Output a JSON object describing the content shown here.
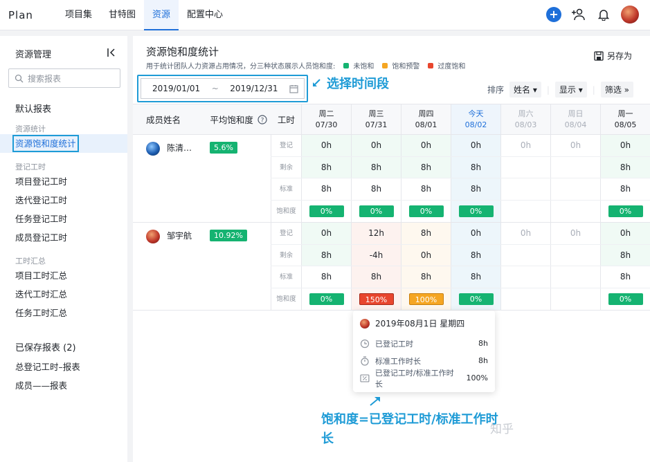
{
  "app": {
    "logo": "Plan"
  },
  "nav": {
    "items": [
      {
        "label": "项目集"
      },
      {
        "label": "甘特图"
      },
      {
        "label": "资源",
        "active": true
      },
      {
        "label": "配置中心"
      }
    ]
  },
  "topbar": {
    "add_icon": "plus-icon",
    "invite_icon": "add-user-icon",
    "bell_icon": "bell-icon"
  },
  "sidebar": {
    "title": "资源管理",
    "search_placeholder": "搜索报表",
    "default_section": "默认报表",
    "groups": [
      {
        "label": "资源统计",
        "items": [
          "资源饱和度统计"
        ]
      },
      {
        "label": "登记工时",
        "items": [
          "项目登记工时",
          "迭代登记工时",
          "任务登记工时",
          "成员登记工时"
        ]
      },
      {
        "label": "工时汇总",
        "items": [
          "项目工时汇总",
          "迭代工时汇总",
          "任务工时汇总"
        ]
      }
    ],
    "saved_title": "已保存报表 (2)",
    "saved_items": [
      "总登记工时–报表",
      "成员——报表"
    ]
  },
  "main": {
    "title": "资源饱和度统计",
    "subtitle": "用于统计团队人力资源占用情况，分三种状态展示人员饱和度:",
    "legend": [
      {
        "label": "未饱和",
        "color": "#15b371"
      },
      {
        "label": "饱和预警",
        "color": "#f5a623"
      },
      {
        "label": "过度饱和",
        "color": "#e8462e"
      }
    ],
    "save_as": "另存为",
    "date_start": "2019/01/01",
    "date_sep": "~",
    "date_end": "2019/12/31",
    "annotation_date": "选择时间段",
    "sort_label": "排序",
    "sort_value": "姓名",
    "display_label": "显示",
    "filter_label": "筛选"
  },
  "table": {
    "col_name": "成员姓名",
    "col_avg": "平均饱和度",
    "col_hours": "工时",
    "days": [
      {
        "dow": "周二",
        "date": "07/30",
        "kind": "normal"
      },
      {
        "dow": "周三",
        "date": "07/31",
        "kind": "normal"
      },
      {
        "dow": "周四",
        "date": "08/01",
        "kind": "normal"
      },
      {
        "dow": "今天",
        "date": "08/02",
        "kind": "today"
      },
      {
        "dow": "周六",
        "date": "08/03",
        "kind": "weekend"
      },
      {
        "dow": "周日",
        "date": "08/04",
        "kind": "weekend"
      },
      {
        "dow": "周一",
        "date": "08/05",
        "kind": "normal"
      }
    ],
    "row_labels": [
      "登记",
      "剩余",
      "标准",
      "饱和度"
    ],
    "members": [
      {
        "name": "陈清…",
        "avg": "5.6%",
        "registered": [
          "0h",
          "0h",
          "0h",
          "0h",
          "0h",
          "0h",
          "0h"
        ],
        "remaining": [
          "8h",
          "8h",
          "8h",
          "8h",
          "",
          "",
          "8h"
        ],
        "standard": [
          "8h",
          "8h",
          "8h",
          "8h",
          "",
          "",
          "8h"
        ],
        "saturation": [
          "0%",
          "0%",
          "0%",
          "0%",
          "",
          "",
          "0%"
        ],
        "status": [
          "g",
          "g",
          "g",
          "g",
          "",
          "",
          "g"
        ]
      },
      {
        "name": "邹宇航",
        "avg": "10.92%",
        "registered": [
          "0h",
          "12h",
          "8h",
          "0h",
          "0h",
          "0h",
          "0h"
        ],
        "remaining": [
          "8h",
          "-4h",
          "0h",
          "8h",
          "",
          "",
          "8h"
        ],
        "standard": [
          "8h",
          "8h",
          "8h",
          "8h",
          "",
          "",
          "8h"
        ],
        "saturation": [
          "0%",
          "150%",
          "100%",
          "0%",
          "",
          "",
          "0%"
        ],
        "status": [
          "g",
          "r",
          "o",
          "g",
          "",
          "",
          "g"
        ]
      }
    ]
  },
  "tooltip": {
    "date": "2019年08月1日 星期四",
    "rows": [
      {
        "label": "已登记工时",
        "value": "8h",
        "icon": "clock-icon"
      },
      {
        "label": "标准工作时长",
        "value": "8h",
        "icon": "timer-icon"
      },
      {
        "label": "已登记工时/标准工作时长",
        "value": "100%",
        "icon": "percent-icon"
      }
    ]
  },
  "annotation_formula": "饱和度=已登记工时/标准工作时长",
  "watermark": "知乎"
}
